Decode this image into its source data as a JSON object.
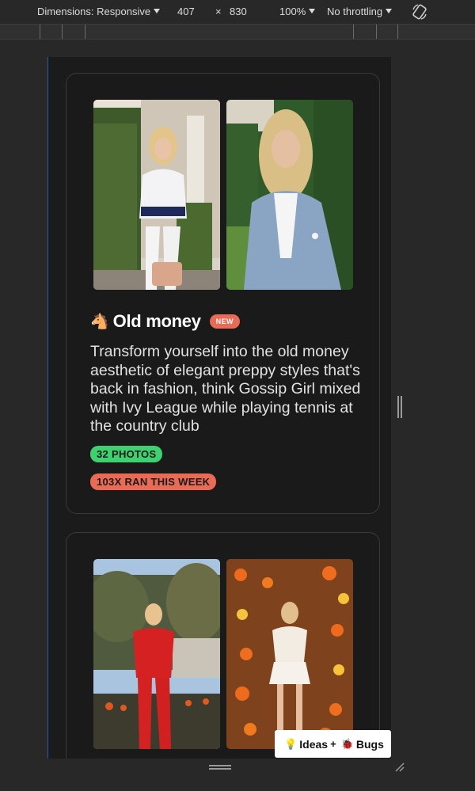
{
  "devtools": {
    "dimensions_label": "Dimensions: Responsive",
    "width": "407",
    "times": "×",
    "height": "830",
    "zoom": "100%",
    "throttling": "No throttling"
  },
  "cards": [
    {
      "emoji": "🐴",
      "title": "Old money",
      "badge": "NEW",
      "description": "Transform yourself into the old money aesthetic of elegant preppy styles that's back in fashion, think Gossip Girl mixed with Ivy League while playing tennis at the country club",
      "photos_label": "32 PHOTOS",
      "runs_label": "103X RAN THIS WEEK"
    }
  ],
  "feedback": {
    "icon_left": "💡",
    "text_ideas": "Ideas",
    "plus": "+",
    "icon_right": "🐞",
    "text_bugs": "Bugs"
  },
  "colors": {
    "accent_new": "#e96a55",
    "photos_pill": "#3fd06f",
    "viewport_border": "#2b56b8"
  }
}
